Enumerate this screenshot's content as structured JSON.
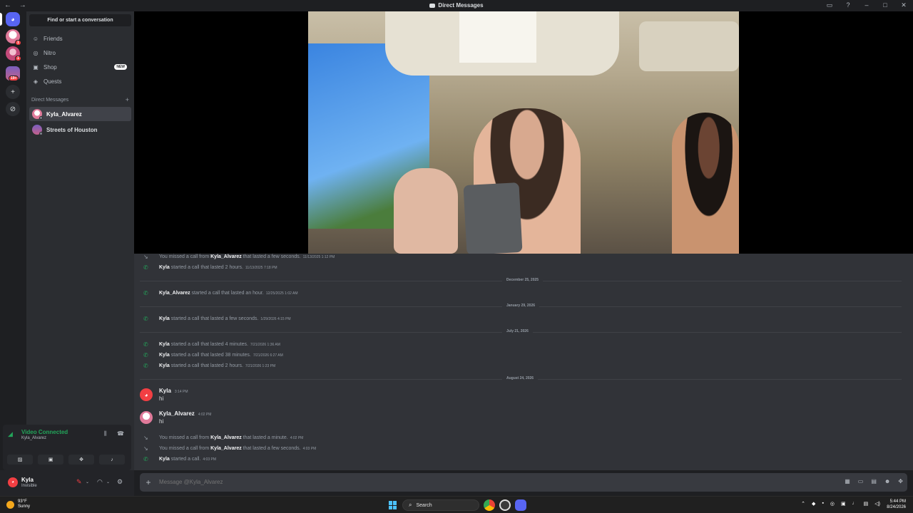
{
  "window": {
    "title": "Direct Messages",
    "nav_arrows": "← →",
    "controls": [
      "▭",
      "?",
      "–",
      "□",
      "✕"
    ]
  },
  "servers": {
    "badges": [
      "1",
      "1",
      "19+"
    ],
    "home_icon": "discord-icon",
    "add_icon": "+",
    "explore_icon": "⊘"
  },
  "sidebar": {
    "find": "Find or start a conversation",
    "nav": [
      {
        "label": "Friends",
        "icon": "friends-icon",
        "glyph": "☺"
      },
      {
        "label": "Nitro",
        "icon": "nitro-icon",
        "glyph": "◎"
      },
      {
        "label": "Shop",
        "icon": "shop-icon",
        "glyph": "▣",
        "badge": "NEW"
      },
      {
        "label": "Quests",
        "icon": "quests-icon",
        "glyph": "◈"
      }
    ],
    "dm_header": "Direct Messages",
    "dm_add": "+",
    "dms": [
      {
        "name": "Kyla_Alvarez",
        "active": true
      },
      {
        "name": "Streets of Houston",
        "active": false
      }
    ]
  },
  "voice": {
    "status": "Video Connected",
    "channel": "Kyla_Alvarez"
  },
  "user": {
    "name": "Kyla",
    "status": "Invisible"
  },
  "chat": {
    "calls_top": [
      {
        "type": "missed",
        "pre": "You missed a call from",
        "who": "Kyla_Alvarez",
        "post": "that lasted a few seconds.",
        "ts": "11/13/2025 1:12 PM"
      },
      {
        "type": "ok",
        "pre": "",
        "who": "Kyla",
        "post": "started a call that lasted 2 hours.",
        "ts": "11/13/2025 7:18 PM"
      }
    ],
    "dividers": [
      "December 25, 2025",
      "January 29, 2026",
      "July 21, 2026",
      "August 24, 2026"
    ],
    "dec": {
      "who": "Kyla_Alvarez",
      "post": "started a call that lasted an hour.",
      "ts": "12/25/2025 1:02 AM"
    },
    "jan": {
      "who": "Kyla",
      "post": "started a call that lasted a few seconds.",
      "ts": "1/29/2026 4:15 PM"
    },
    "jul": [
      {
        "who": "Kyla",
        "post": "started a call that lasted 4 minutes.",
        "ts": "7/21/2026 1:36 AM"
      },
      {
        "who": "Kyla",
        "post": "started a call that lasted 38 minutes.",
        "ts": "7/21/2026 6:27 AM"
      },
      {
        "who": "Kyla",
        "post": "started a call that lasted 2 hours.",
        "ts": "7/21/2026 1:23 PM"
      }
    ],
    "messages": [
      {
        "author": "Kyla",
        "time": "3:14 PM",
        "text": "hi"
      },
      {
        "author": "Kyla_Alvarez",
        "time": "4:02 PM",
        "text": "hi"
      }
    ],
    "calls_bottom": [
      {
        "type": "missed",
        "pre": "You missed a call from",
        "who": "Kyla_Alvarez",
        "post": "that lasted a minute.",
        "ts": "4:02 PM"
      },
      {
        "type": "missed",
        "pre": "You missed a call from",
        "who": "Kyla_Alvarez",
        "post": "that lasted a few seconds.",
        "ts": "4:03 PM"
      },
      {
        "type": "ok",
        "pre": "",
        "who": "Kyla",
        "post": "started a call.",
        "ts": "4:03 PM"
      }
    ]
  },
  "composer": {
    "placeholder": "Message @Kyla_Alvarez"
  },
  "taskbar": {
    "temp": "93°F",
    "condition": "Sunny",
    "search": "Search",
    "time": "5:44 PM",
    "date": "8/24/2026"
  },
  "colors": {
    "accent": "#5865f2",
    "online": "#23a55a",
    "danger": "#f23f43"
  }
}
